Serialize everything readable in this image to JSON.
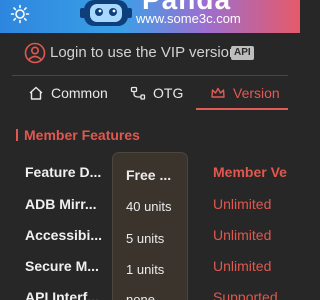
{
  "header": {
    "app_name": "Panda",
    "site_url": "www.some3c.com",
    "theme_icon": "sun-icon",
    "logo_icon": "robot-logo-icon"
  },
  "login": {
    "text": "Login to use the VIP version!",
    "badge": "API",
    "icon": "user-circle-icon"
  },
  "tabs": [
    {
      "label": "Common",
      "icon": "home-icon"
    },
    {
      "label": "OTG",
      "icon": "otg-cable-icon"
    },
    {
      "label": "Version",
      "icon": "crown-icon",
      "active": true
    }
  ],
  "section": {
    "title": "Member Features"
  },
  "table": {
    "headers": {
      "feature": "Feature D...",
      "free": "Free ...",
      "member": "Member Ve"
    },
    "rows": [
      {
        "feature": "ADB Mirr...",
        "free": "40 units",
        "member": "Unlimited"
      },
      {
        "feature": "Accessibi...",
        "free": "5 units",
        "member": "Unlimited"
      },
      {
        "feature": "Secure M...",
        "free": "1 units",
        "member": "Unlimited"
      },
      {
        "feature": "API Interf...",
        "free": "none",
        "member": "Supported"
      }
    ]
  },
  "colors": {
    "accent": "#e0584f",
    "background": "#272727",
    "header_gradient": [
      "#2e86de",
      "#9b6fd0",
      "#e65a6a"
    ]
  }
}
